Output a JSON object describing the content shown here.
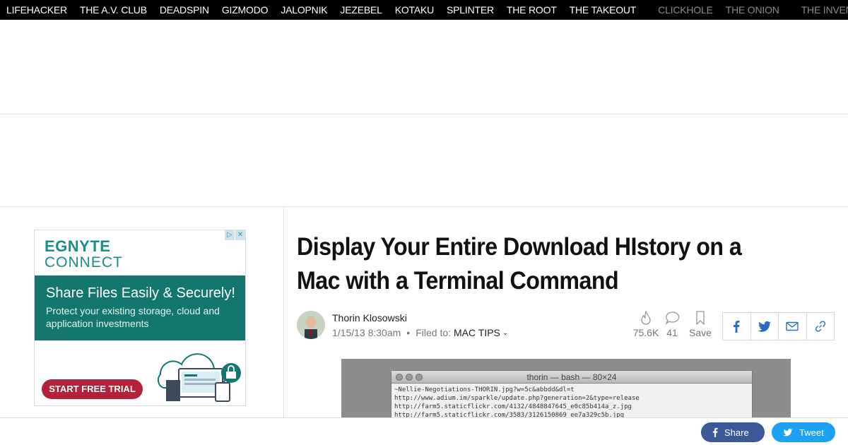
{
  "network_nav": {
    "primary": [
      "LIFEHACKER",
      "THE A.V. CLUB",
      "DEADSPIN",
      "GIZMODO",
      "JALOPNIK",
      "JEZEBEL",
      "KOTAKU",
      "SPLINTER",
      "THE ROOT",
      "THE TAKEOUT"
    ],
    "secondary": [
      "CLICKHOLE",
      "THE ONION"
    ],
    "tertiary": [
      "THE INVENTORY"
    ]
  },
  "ad": {
    "brand_line1": "EGNYTE",
    "brand_line2": "CONNECT",
    "headline": "Share Files Easily & Securely!",
    "body": "Protect your existing storage, cloud and application investments",
    "cta": "START FREE TRIAL",
    "adchoices": [
      "▷",
      "✕"
    ]
  },
  "article": {
    "headline": "Display Your Entire Download HIstory on a Mac with a Terminal Command",
    "author": "Thorin Klosowski",
    "date": "1/15/13 8:30am",
    "dot": "•",
    "filed_label": "Filed to:",
    "filed_tag": "MAC TIPS",
    "chevron": "⌄",
    "stats": {
      "views": "75.6K",
      "comments": "41",
      "save_label": "Save"
    }
  },
  "terminal": {
    "title": "thorin — bash — 80×24",
    "lines": [
      "~Nellie-Negotiations-THORIN.jpg?w=5c&abbdd&dl=t",
      "http://www.adium.im/sparkle/update.php?generation=2&type=release",
      "http://farm5.staticflickr.com/4132/4848847645_e0c85b414a_z.jpg",
      "http://farm5.staticflickr.com/3583/3126150869_ee7a329c5b.jpg"
    ]
  },
  "bottom_share": {
    "share_label": "Share",
    "tweet_label": "Tweet"
  },
  "colors": {
    "facebook": "#3b5998",
    "twitter": "#1da1f2",
    "egnyte_teal": "#13766f",
    "cta_red": "#b3223b"
  }
}
